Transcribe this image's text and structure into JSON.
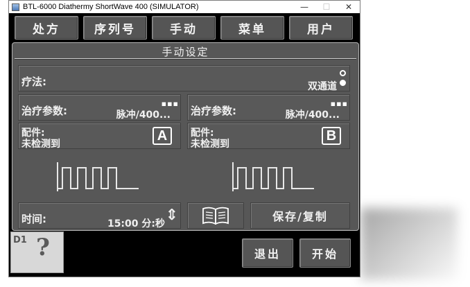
{
  "window": {
    "title": "BTL-6000 Diathermy ShortWave 400 (SIMULATOR)"
  },
  "window_controls": {
    "minimize": "—",
    "maximize": "☐",
    "close": "✕"
  },
  "top_menu": [
    "处方",
    "序列号",
    "手动",
    "菜单",
    "用户"
  ],
  "panel": {
    "title": "手动设定",
    "therapy_label": "疗法:",
    "therapy_value": "双通道",
    "channel_a": {
      "params_label": "治疗参数:",
      "params_value": "脉冲/400...",
      "accessory_label": "配件:",
      "accessory_status": "未检测到",
      "letter": "A"
    },
    "channel_b": {
      "params_label": "治疗参数:",
      "params_value": "脉冲/400...",
      "accessory_label": "配件:",
      "accessory_status": "未检测到",
      "letter": "B"
    },
    "more_glyph": "▪▪▪",
    "time_label": "时间:",
    "time_value": "15:00 分:秒",
    "time_stepper_glyph": "⇕",
    "save_copy_label": "保存/复制"
  },
  "help": {
    "code": "D1",
    "glyph": "?"
  },
  "bottom_buttons": {
    "exit": "退出",
    "start": "开始"
  },
  "colors": {
    "background": "#000000",
    "panel": "#575757",
    "button": "#555555",
    "text": "#f0f0f0"
  }
}
